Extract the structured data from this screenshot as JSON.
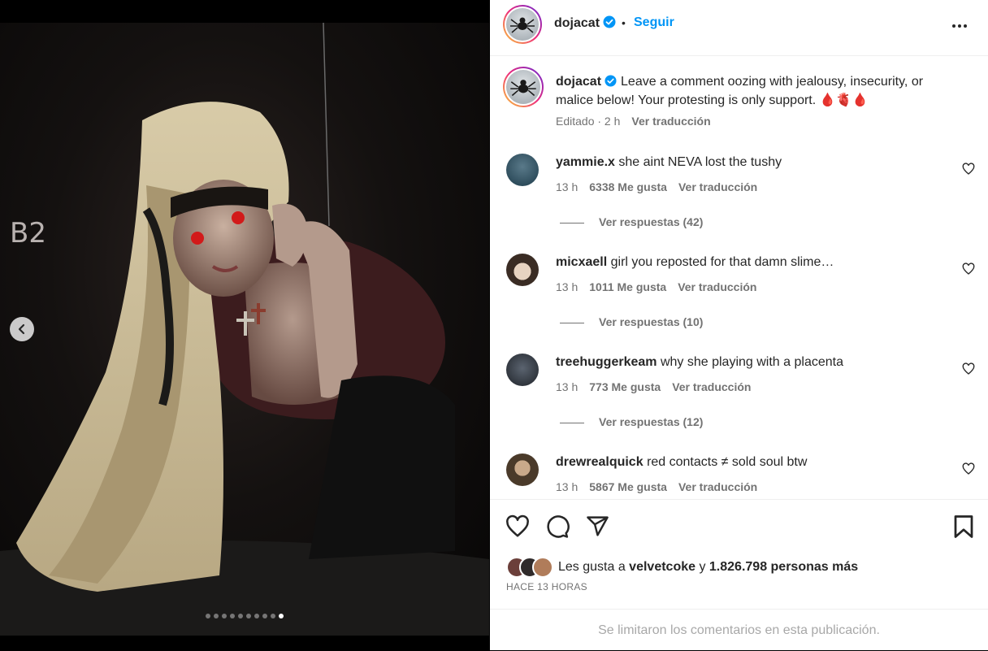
{
  "post": {
    "username": "dojacat",
    "separator": "•",
    "follow_label": "Seguir",
    "caption": "Leave a comment oozing with jealousy, insecurity, or malice below! Your protesting is only support. 🩸🫀🩸",
    "caption_meta": "Editado · 2 h",
    "translate_label": "Ver traducción",
    "media_dots_total": 10,
    "media_dots_active": 9,
    "photo_wall_label": "B2"
  },
  "comments": [
    {
      "username": "yammie.x",
      "text": "she aint NEVA lost the tushy",
      "time": "13 h",
      "likes": "6338 Me gusta",
      "translate": "Ver traducción",
      "replies": "Ver respuestas (42)",
      "avatar_color": "#1d3b4a"
    },
    {
      "username": "micxaell",
      "text": "girl you reposted for that damn slime…",
      "time": "13 h",
      "likes": "1011 Me gusta",
      "translate": "Ver traducción",
      "replies": "Ver respuestas (10)",
      "avatar_color": "#c9b8a6"
    },
    {
      "username": "treehuggerkeam",
      "text": "why she playing with a placenta",
      "time": "13 h",
      "likes": "773 Me gusta",
      "translate": "Ver traducción",
      "replies": "Ver respuestas (12)",
      "avatar_color": "#2b2f36"
    },
    {
      "username": "drewrealquick",
      "text": "red contacts ≠ sold soul btw",
      "time": "13 h",
      "likes": "5867 Me gusta",
      "translate": "Ver traducción",
      "replies": "",
      "avatar_color": "#6b5a3e"
    }
  ],
  "footer": {
    "likes_prefix": "Les gusta a ",
    "likes_user": "velvetcoke",
    "likes_middle": " y ",
    "likes_count": "1.826.798 personas más",
    "time_ago": "HACE 13 HORAS",
    "comments_limited": "Se limitaron los comentarios en esta publicación."
  },
  "colors": {
    "accent": "#0095f6",
    "verified": "#0095f6",
    "muted": "#737373"
  }
}
